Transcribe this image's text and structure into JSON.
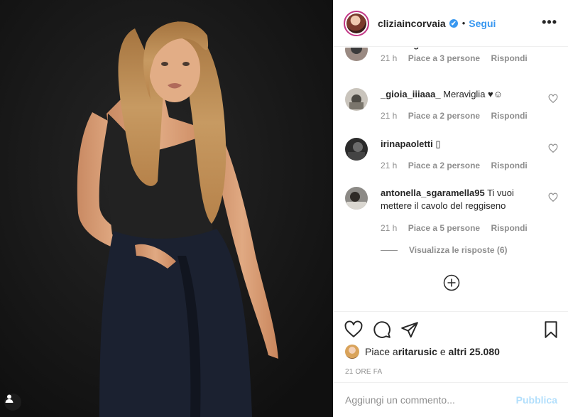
{
  "header": {
    "username": "cliziaincorvaia",
    "verified_mark": "✔",
    "separator": "•",
    "follow_label": "Segui",
    "more_label": "•••"
  },
  "comments": [
    {
      "username": "artismaglie",
      "text": "♥ ♥ ♥ ♥",
      "time": "21 h",
      "likes": "Piace a 3 persone",
      "reply": "Rispondi"
    },
    {
      "username": "_gioia_iiiaaa_",
      "text": "Meraviglia ♥☺",
      "time": "21 h",
      "likes": "Piace a 2 persone",
      "reply": "Rispondi"
    },
    {
      "username": "irinapaoletti",
      "text": "▯",
      "time": "21 h",
      "likes": "Piace a 2 persone",
      "reply": "Rispondi"
    },
    {
      "username": "antonella_sgaramella95",
      "text": "Ti vuoi mettere il cavolo del reggiseno",
      "time": "21 h",
      "likes": "Piace a 5 persone",
      "reply": "Rispondi"
    }
  ],
  "view_replies": "Visualizza le risposte (6)",
  "likes": {
    "prefix": "Piace a ",
    "user": "ritarusic",
    "middle": " e ",
    "others": "altri 25.080"
  },
  "time_ago": "21 ORE FA",
  "add_comment": {
    "placeholder": "Aggiungi un commento...",
    "publish_label": "Pubblica"
  },
  "colors": {
    "accent": "#3897f0",
    "publish_disabled": "#b2dffc",
    "muted": "#8e8e8e",
    "text": "#262626",
    "photo_background": "#171717"
  },
  "icons": {
    "like": "heart-icon",
    "comment": "comment-icon",
    "share": "share-icon",
    "save": "bookmark-icon",
    "load_more": "plus-circle-icon",
    "tag": "user-tag-icon"
  }
}
